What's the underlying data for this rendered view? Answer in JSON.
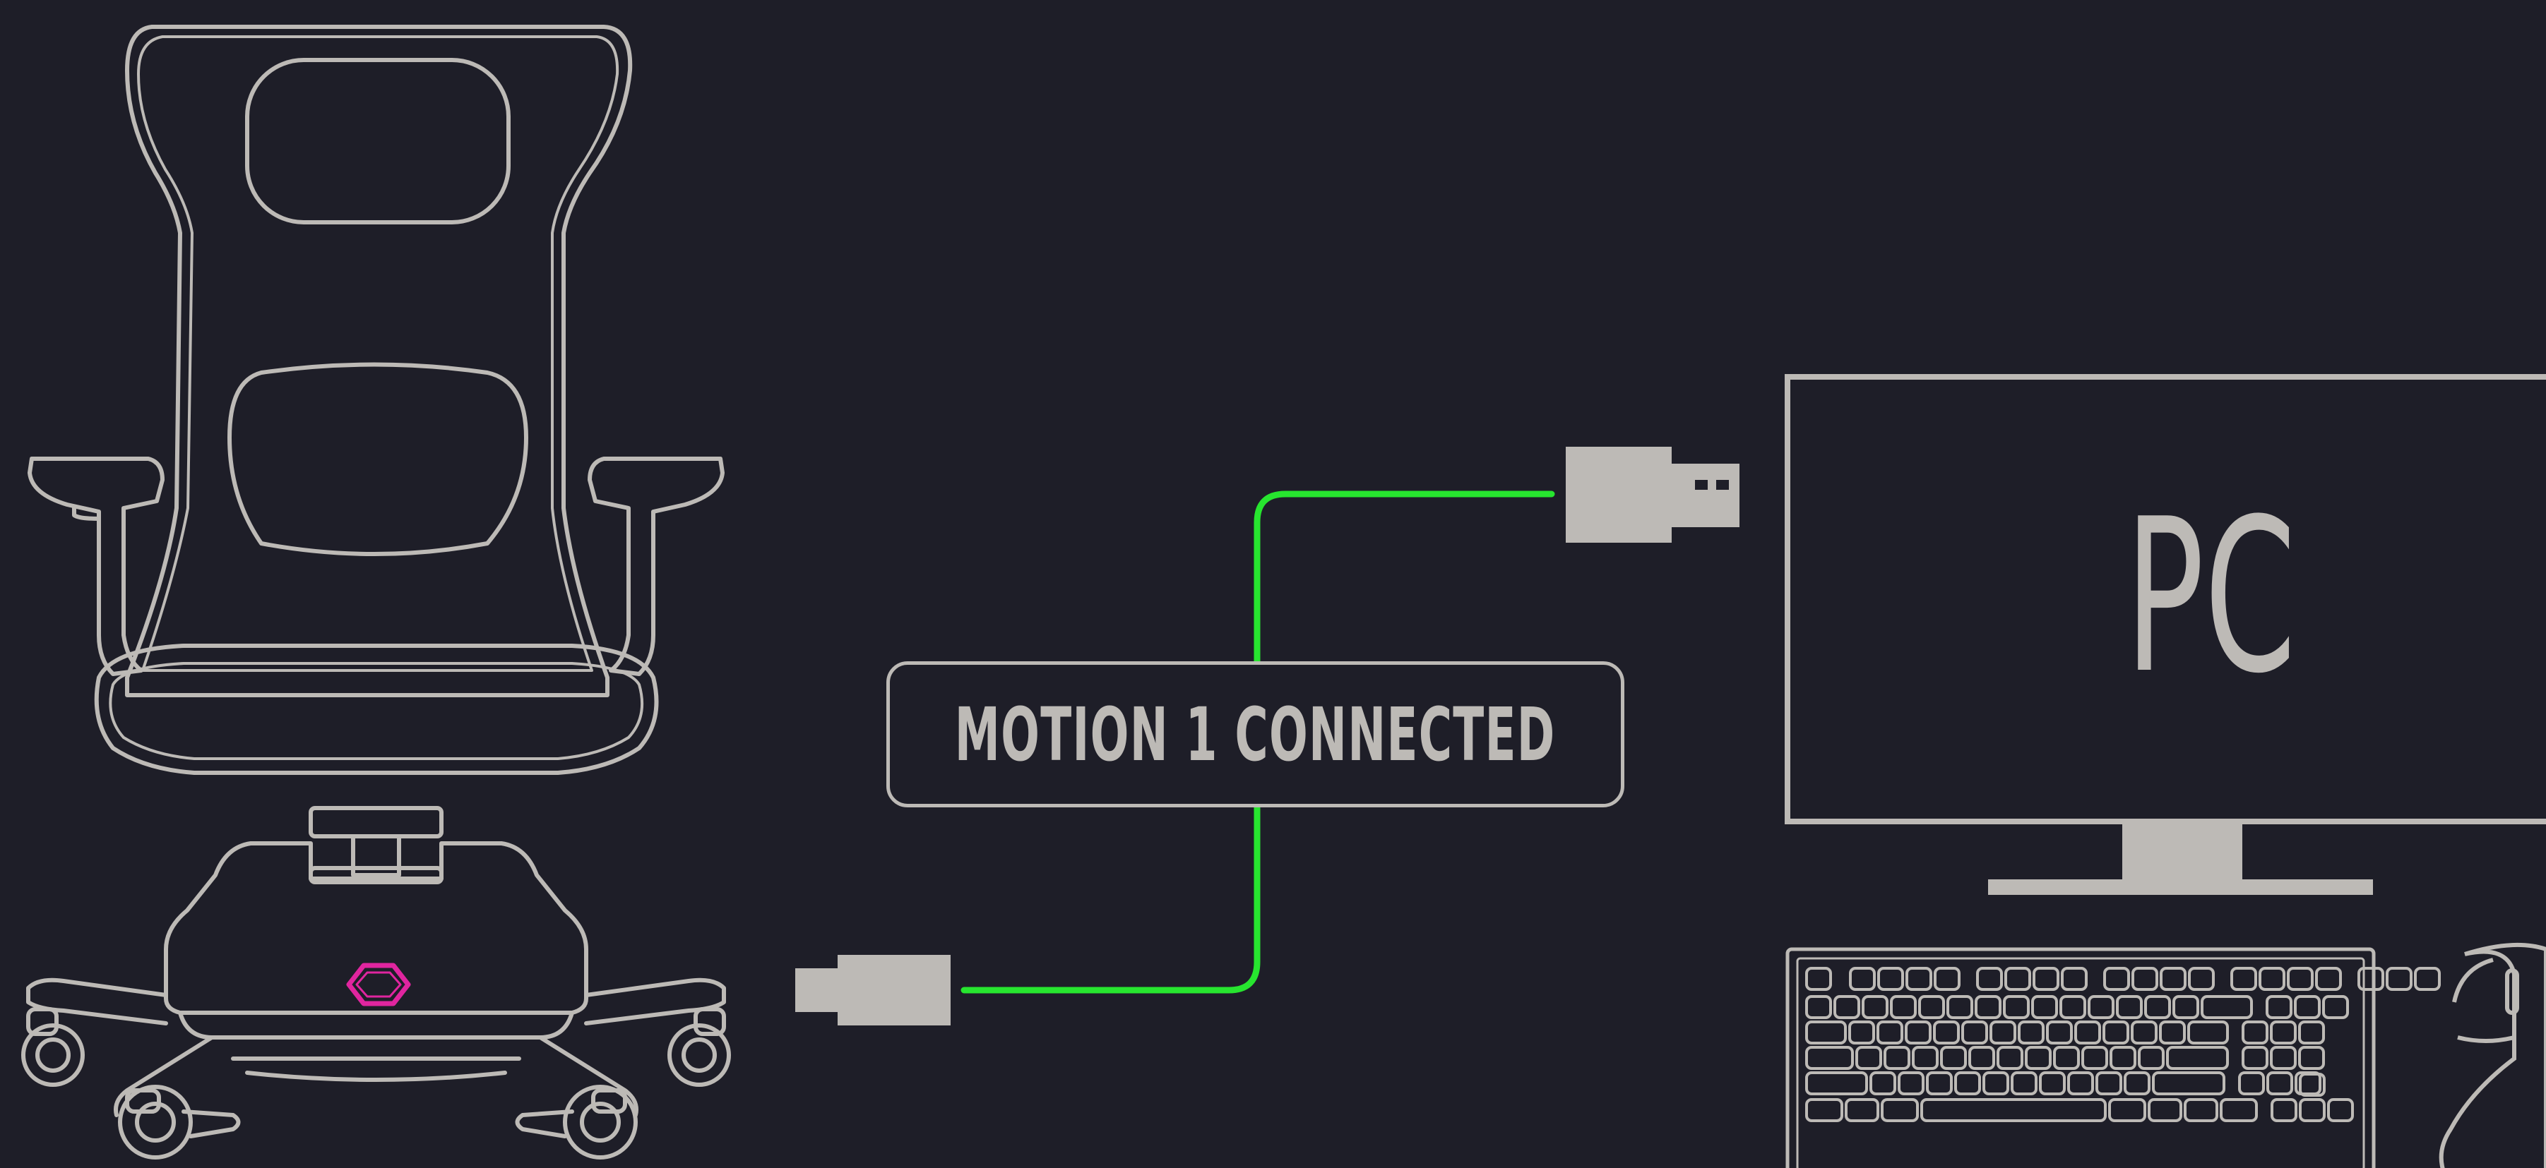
{
  "status": {
    "label": "MOTION 1 CONNECTED"
  },
  "monitor": {
    "label": "PC"
  },
  "colors": {
    "background": "#1e1e28",
    "line_art": "#bdbab6",
    "cable": "#27e52f",
    "logo": "#e0259f"
  },
  "icons": [
    "gaming-chair-icon",
    "usb-plug-icon",
    "usb-cable-icon",
    "monitor-icon",
    "keyboard-icon",
    "mouse-icon"
  ]
}
